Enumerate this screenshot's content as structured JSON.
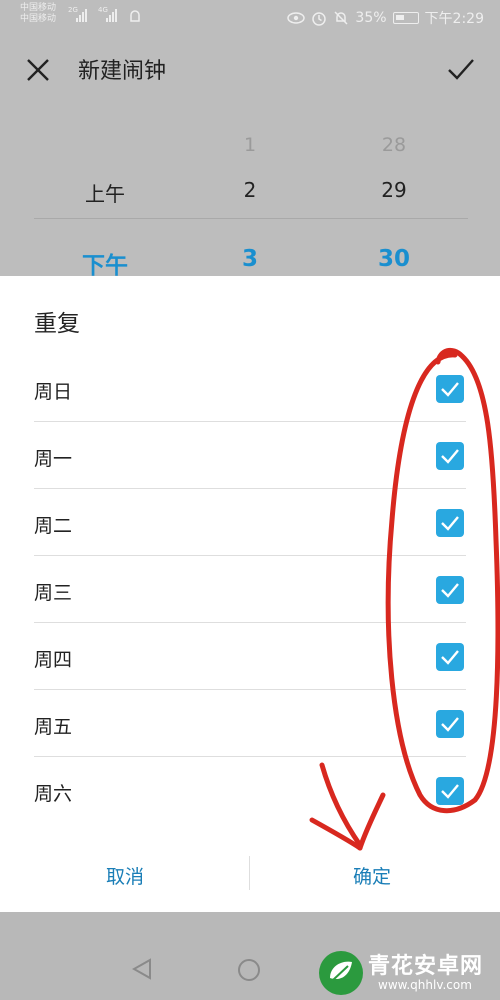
{
  "status_bar": {
    "carrier_1": "中国移动",
    "carrier_2": "中国移动",
    "net_1": "2G",
    "net_2": "4G",
    "battery": "35%",
    "time": "下午2:29"
  },
  "app_bar": {
    "title": "新建闹钟"
  },
  "time_picker": {
    "period": {
      "above": "",
      "prev": "上午",
      "selected": "下午"
    },
    "hour": {
      "above": "1",
      "prev": "2",
      "selected": "3"
    },
    "minute": {
      "above": "28",
      "prev": "29",
      "selected": "30"
    }
  },
  "repeat_dialog": {
    "title": "重复",
    "days": [
      {
        "label": "周日",
        "checked": true
      },
      {
        "label": "周一",
        "checked": true
      },
      {
        "label": "周二",
        "checked": true
      },
      {
        "label": "周三",
        "checked": true
      },
      {
        "label": "周四",
        "checked": true
      },
      {
        "label": "周五",
        "checked": true
      },
      {
        "label": "周六",
        "checked": true
      }
    ],
    "cancel_label": "取消",
    "confirm_label": "确定"
  },
  "watermark": {
    "name": "青花安卓网",
    "url": "www.qhhlv.com"
  },
  "colors": {
    "accent": "#29a8e0",
    "selected_text": "#1a8fcf",
    "annotation": "#d8281f"
  }
}
